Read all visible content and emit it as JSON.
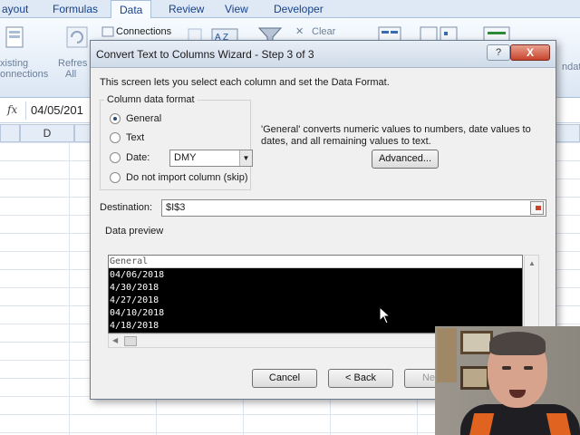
{
  "excel": {
    "ribbon_tabs": [
      "ayout",
      "Formulas",
      "Data",
      "Review",
      "View",
      "Developer"
    ],
    "active_tab": "Data",
    "ribbon": {
      "existing_connections": [
        "xisting",
        "onnections"
      ],
      "refresh_all": [
        "Refres",
        "All"
      ],
      "connections": "Connections",
      "clear": "Clear",
      "side_text": "ndat"
    },
    "formula_bar": {
      "fx": "fx",
      "value": "04/05/201"
    },
    "column_headers": [
      "D"
    ],
    "dialog": {
      "title": "Convert Text to Columns Wizard - Step 3 of 3",
      "help_label": "?",
      "close_label": "X",
      "intro": "This screen lets you select each column and set the Data Format.",
      "column_data_format": {
        "legend": "Column data format",
        "options": [
          {
            "label": "General",
            "checked": true
          },
          {
            "label": "Text",
            "checked": false
          },
          {
            "label": "Date:",
            "checked": false
          },
          {
            "label": "Do not import column (skip)",
            "checked": false
          }
        ],
        "date_format": "DMY"
      },
      "general_note": "'General' converts numeric values to numbers, date values to dates, and all remaining values to text.",
      "advanced_button": "Advanced...",
      "destination": {
        "label": "Destination:",
        "value": "$I$3"
      },
      "preview": {
        "label": "Data preview",
        "header": "General",
        "rows": [
          "04/06/2018",
          "4/30/2018",
          "4/27/2018",
          "04/10/2018",
          "4/18/2018"
        ]
      },
      "buttons": {
        "cancel": "Cancel",
        "back": "< Back",
        "next": "Next >"
      }
    }
  },
  "colors": {
    "ribbon_bg": "#dfe8f5",
    "title_bar": "#cfdbe9",
    "close_button": "#c8442c",
    "preview_bg": "#000000"
  },
  "icons": [
    "fx-icon",
    "connections-icon",
    "clear-filter-icon",
    "cursor-arrow-icon",
    "destination-picker-icon",
    "help-icon",
    "close-icon"
  ]
}
